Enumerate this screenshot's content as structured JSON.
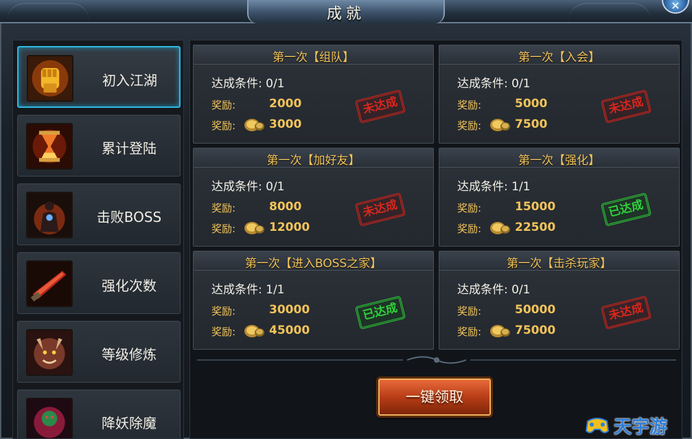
{
  "window": {
    "title": "成就",
    "close_symbol": "✕"
  },
  "sidebar": {
    "items": [
      {
        "label": "初入江湖",
        "icon": "fist-icon",
        "active": true
      },
      {
        "label": "累计登陆",
        "icon": "hourglass-icon",
        "active": false
      },
      {
        "label": "击败BOSS",
        "icon": "demon-figure-icon",
        "active": false
      },
      {
        "label": "强化次数",
        "icon": "blade-icon",
        "active": false
      },
      {
        "label": "等级修炼",
        "icon": "dragon-head-icon",
        "active": false
      },
      {
        "label": "降妖除魔",
        "icon": "monster-icon",
        "active": false
      }
    ]
  },
  "achievements": [
    {
      "title": "第一次【组队】",
      "condition": "达成条件: 0/1",
      "reward_label": "奖励:",
      "reward_gold": "2000",
      "reward_coin": "3000",
      "status": "未达成",
      "status_type": "fail"
    },
    {
      "title": "第一次【入会】",
      "condition": "达成条件: 0/1",
      "reward_label": "奖励:",
      "reward_gold": "5000",
      "reward_coin": "7500",
      "status": "未达成",
      "status_type": "fail"
    },
    {
      "title": "第一次【加好友】",
      "condition": "达成条件: 0/1",
      "reward_label": "奖励:",
      "reward_gold": "8000",
      "reward_coin": "12000",
      "status": "未达成",
      "status_type": "fail"
    },
    {
      "title": "第一次【强化】",
      "condition": "达成条件: 1/1",
      "reward_label": "奖励:",
      "reward_gold": "15000",
      "reward_coin": "22500",
      "status": "已达成",
      "status_type": "done"
    },
    {
      "title": "第一次【进入BOSS之家】",
      "condition": "达成条件: 1/1",
      "reward_label": "奖励:",
      "reward_gold": "30000",
      "reward_coin": "45000",
      "status": "已达成",
      "status_type": "done"
    },
    {
      "title": "第一次【击杀玩家】",
      "condition": "达成条件: 0/1",
      "reward_label": "奖励:",
      "reward_gold": "50000",
      "reward_coin": "75000",
      "status": "未达成",
      "status_type": "fail"
    }
  ],
  "claim_all_button": "一键领取",
  "watermark": {
    "text": "天宇游",
    "icon": "gamepad-logo-icon"
  },
  "colors": {
    "accent_gold": "#f3c45a",
    "active_border": "#2fb8e0",
    "fail_red": "#d8261c",
    "done_green": "#2fd03a",
    "button_orange": "#b83d17"
  }
}
